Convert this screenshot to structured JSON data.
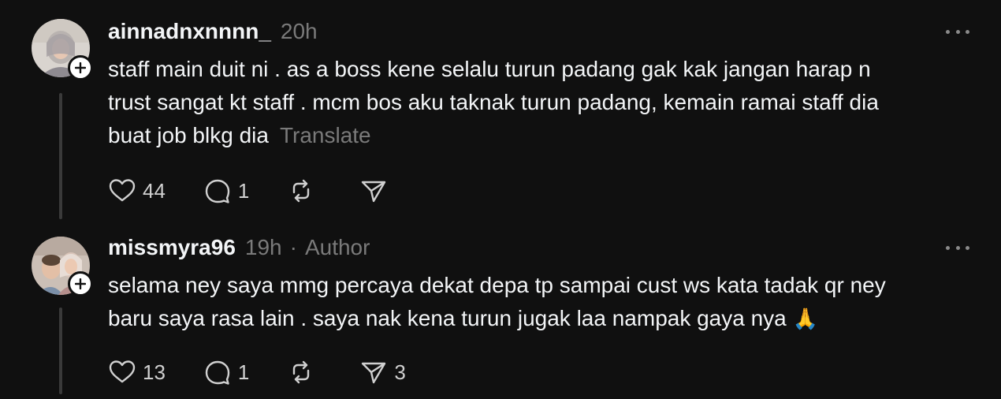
{
  "comments": [
    {
      "username": "ainnadnxnnnn_",
      "time": "20h",
      "body_lines": [
        "staff main duit ni . as a boss kene selalu turun padang gak kak jangan harap n",
        "trust sangat kt staff . mcm bos aku taknak turun padang, kemain ramai staff dia",
        "buat job blkg dia"
      ],
      "translate_label": "Translate",
      "likes": "44",
      "replies": "1",
      "reposts": "",
      "shares": "",
      "icons": [
        "follow-plus-icon",
        "heart-icon",
        "comment-icon",
        "repost-icon",
        "share-icon",
        "more-icon"
      ]
    },
    {
      "username": "missmyra96",
      "time": "19h",
      "separator": "·",
      "author_label": "Author",
      "body_lines": [
        "selama ney saya mmg percaya dekat depa tp sampai cust ws kata tadak qr ney",
        "baru saya rasa lain . saya nak kena turun jugak laa nampak gaya nya"
      ],
      "emoji": "🙏",
      "likes": "13",
      "replies": "1",
      "reposts": "",
      "shares": "3",
      "icons": [
        "follow-plus-icon",
        "heart-icon",
        "comment-icon",
        "repost-icon",
        "share-icon",
        "more-icon"
      ]
    }
  ],
  "colors": {
    "background": "#101010",
    "text": "#f3f5f7",
    "muted": "#7a7a7a",
    "thread_line": "#3a3a3a"
  }
}
